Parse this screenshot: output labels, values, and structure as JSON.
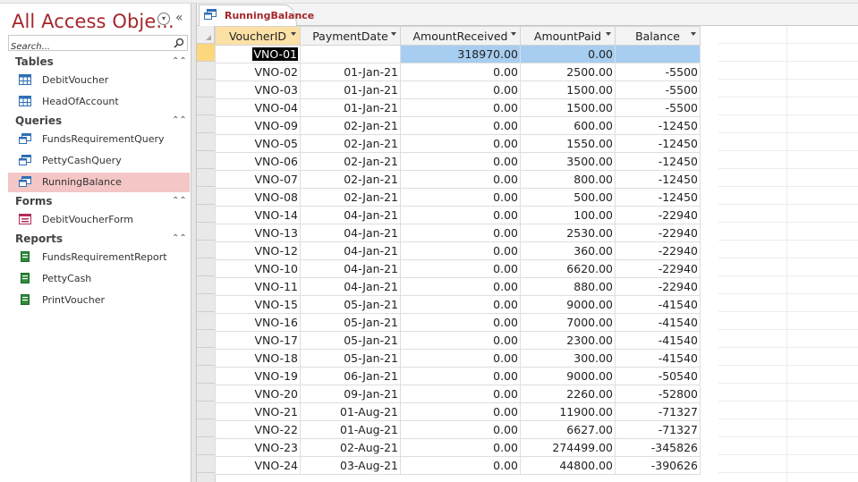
{
  "nav": {
    "title": "All Access Obje...",
    "search_placeholder": "Search...",
    "groups": [
      {
        "label": "Tables",
        "items": [
          "DebitVoucher",
          "HeadOfAccount"
        ]
      },
      {
        "label": "Queries",
        "items": [
          "FundsRequirementQuery",
          "PettyCashQuery",
          "RunningBalance"
        ]
      },
      {
        "label": "Forms",
        "items": [
          "DebitVoucherForm"
        ]
      },
      {
        "label": "Reports",
        "items": [
          "FundsRequirementReport",
          "PettyCash",
          "PrintVoucher"
        ]
      }
    ],
    "selected_item": "RunningBalance"
  },
  "tab": {
    "label": "RunningBalance"
  },
  "datasheet": {
    "columns": [
      "VoucherID",
      "PaymentDate",
      "AmountReceived",
      "AmountPaid",
      "Balance"
    ],
    "rows": [
      [
        "VNO-01",
        "",
        "318970.00",
        "0.00",
        ""
      ],
      [
        "VNO-02",
        "01-Jan-21",
        "0.00",
        "2500.00",
        "-5500"
      ],
      [
        "VNO-03",
        "01-Jan-21",
        "0.00",
        "1500.00",
        "-5500"
      ],
      [
        "VNO-04",
        "01-Jan-21",
        "0.00",
        "1500.00",
        "-5500"
      ],
      [
        "VNO-09",
        "02-Jan-21",
        "0.00",
        "600.00",
        "-12450"
      ],
      [
        "VNO-05",
        "02-Jan-21",
        "0.00",
        "1550.00",
        "-12450"
      ],
      [
        "VNO-06",
        "02-Jan-21",
        "0.00",
        "3500.00",
        "-12450"
      ],
      [
        "VNO-07",
        "02-Jan-21",
        "0.00",
        "800.00",
        "-12450"
      ],
      [
        "VNO-08",
        "02-Jan-21",
        "0.00",
        "500.00",
        "-12450"
      ],
      [
        "VNO-14",
        "04-Jan-21",
        "0.00",
        "100.00",
        "-22940"
      ],
      [
        "VNO-13",
        "04-Jan-21",
        "0.00",
        "2530.00",
        "-22940"
      ],
      [
        "VNO-12",
        "04-Jan-21",
        "0.00",
        "360.00",
        "-22940"
      ],
      [
        "VNO-10",
        "04-Jan-21",
        "0.00",
        "6620.00",
        "-22940"
      ],
      [
        "VNO-11",
        "04-Jan-21",
        "0.00",
        "880.00",
        "-22940"
      ],
      [
        "VNO-15",
        "05-Jan-21",
        "0.00",
        "9000.00",
        "-41540"
      ],
      [
        "VNO-16",
        "05-Jan-21",
        "0.00",
        "7000.00",
        "-41540"
      ],
      [
        "VNO-17",
        "05-Jan-21",
        "0.00",
        "2300.00",
        "-41540"
      ],
      [
        "VNO-18",
        "05-Jan-21",
        "0.00",
        "300.00",
        "-41540"
      ],
      [
        "VNO-19",
        "06-Jan-21",
        "0.00",
        "9000.00",
        "-50540"
      ],
      [
        "VNO-20",
        "09-Jan-21",
        "0.00",
        "2260.00",
        "-52800"
      ],
      [
        "VNO-21",
        "01-Aug-21",
        "0.00",
        "11900.00",
        "-71327"
      ],
      [
        "VNO-22",
        "01-Aug-21",
        "0.00",
        "6627.00",
        "-71327"
      ],
      [
        "VNO-23",
        "02-Aug-21",
        "0.00",
        "274499.00",
        "-345826"
      ],
      [
        "VNO-24",
        "03-Aug-21",
        "0.00",
        "44800.00",
        "-390626"
      ]
    ]
  }
}
